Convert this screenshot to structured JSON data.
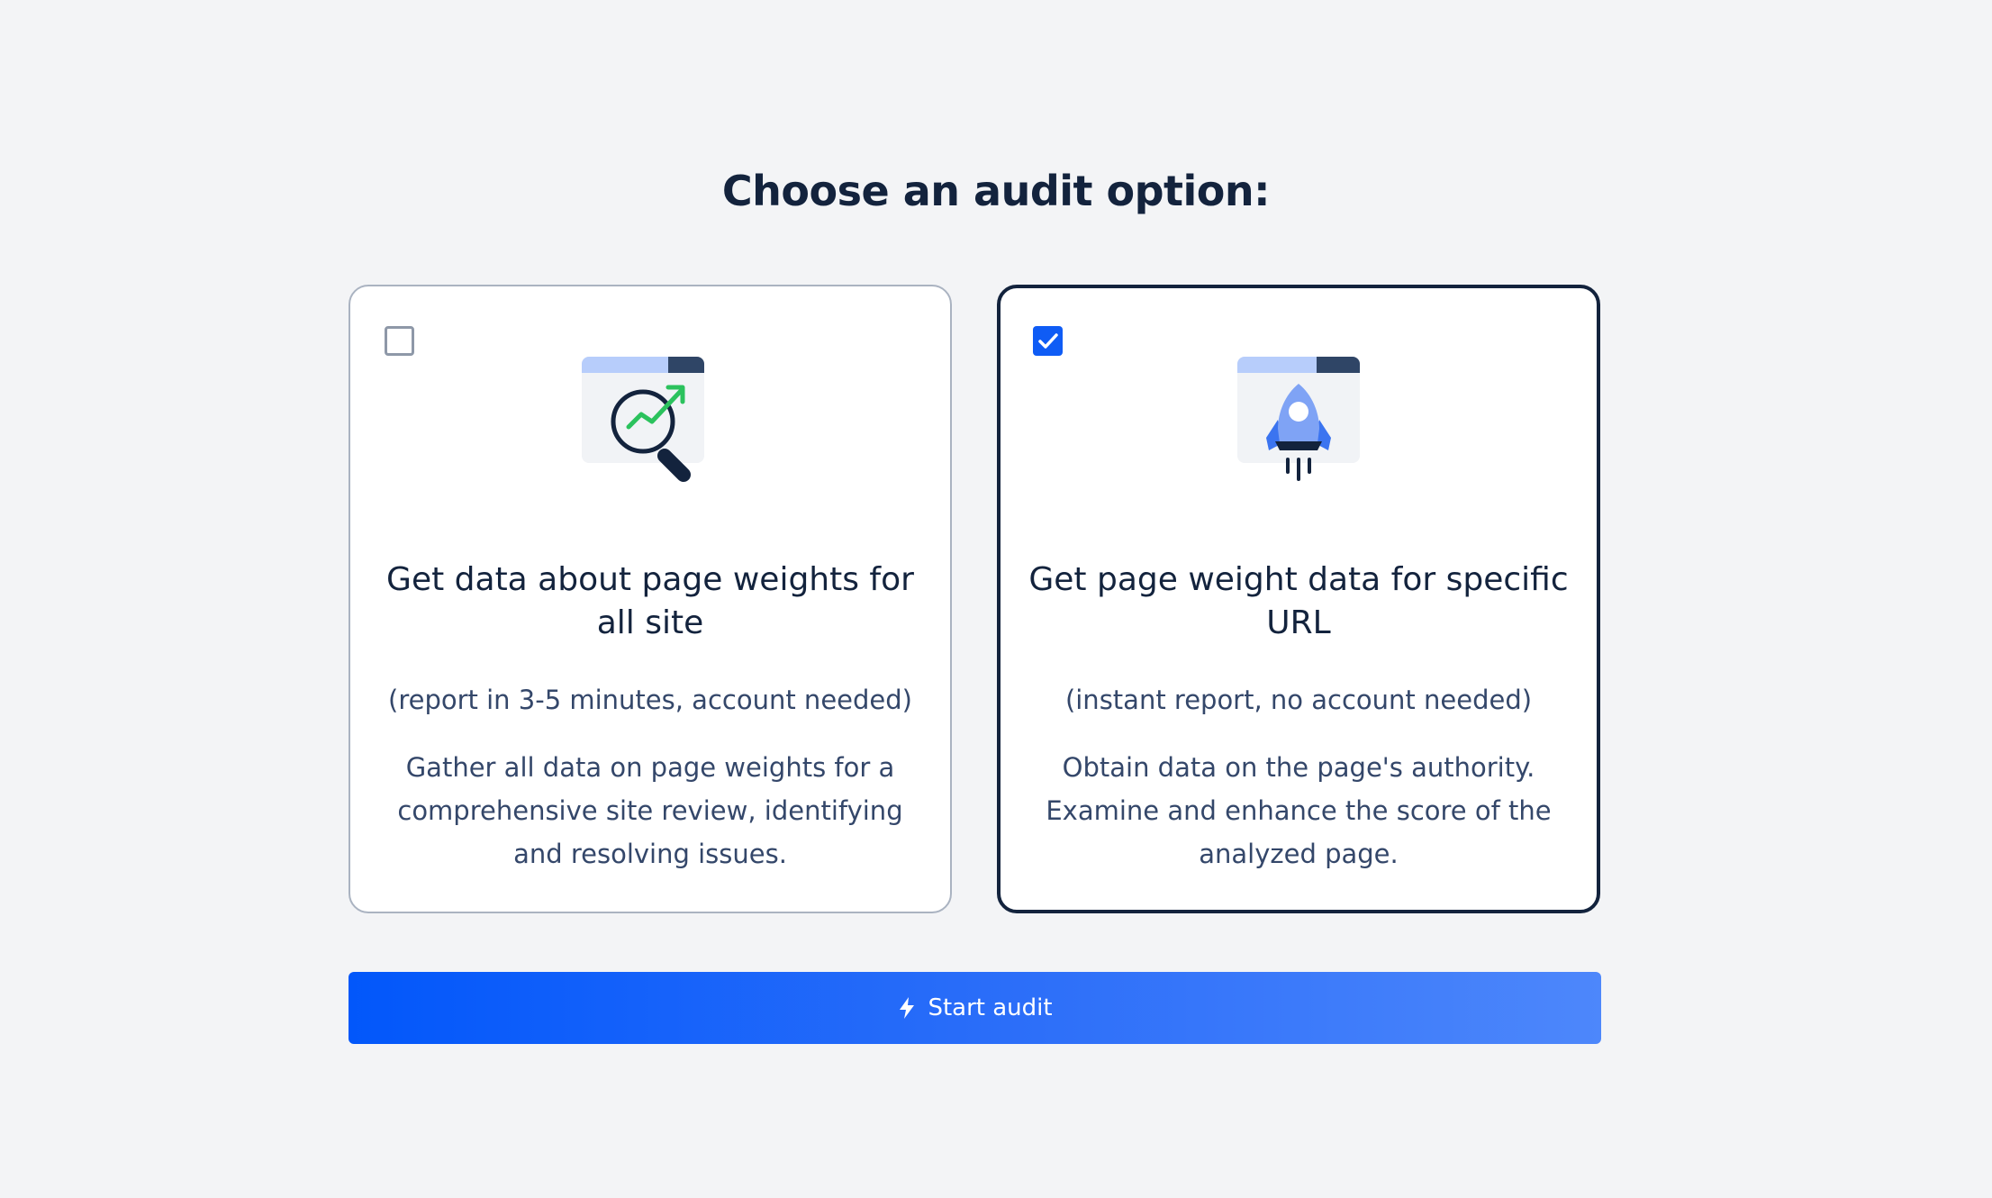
{
  "heading": "Choose an audit option:",
  "options": [
    {
      "checked": false,
      "icon": "magnifier-chart-icon",
      "title": "Get data about page weights for all site",
      "note": "(report in 3-5 minutes, account needed)",
      "description": "Gather all data on page weights for a comprehensive site review, identifying and resolving issues."
    },
    {
      "checked": true,
      "icon": "rocket-icon",
      "title": "Get page weight data for specific URL",
      "note": "(instant report, no account needed)",
      "description": "Obtain data on the page's authority. Examine and enhance the score of the analyzed page."
    }
  ],
  "start_button": {
    "label": "Start audit",
    "icon": "lightning-icon"
  },
  "colors": {
    "background": "#f3f4f6",
    "text_dark": "#13233d",
    "accent_blue": "#0f5cf5",
    "illustration_light_blue": "#b7cdfb",
    "illustration_green": "#2bc25d"
  }
}
